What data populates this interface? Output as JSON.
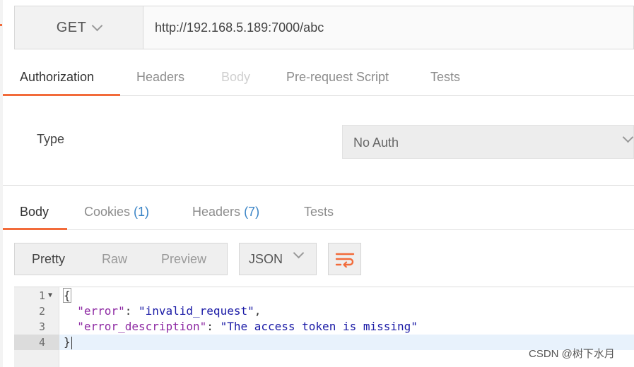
{
  "request": {
    "method": "GET",
    "url": "http://192.168.5.189:7000/abc"
  },
  "request_tabs": [
    {
      "label": "Authorization",
      "state": "active"
    },
    {
      "label": "Headers",
      "state": "normal"
    },
    {
      "label": "Body",
      "state": "disabled"
    },
    {
      "label": "Pre-request Script",
      "state": "normal"
    },
    {
      "label": "Tests",
      "state": "normal"
    }
  ],
  "auth": {
    "type_label": "Type",
    "type_value": "No Auth"
  },
  "response_tabs": [
    {
      "label": "Body",
      "state": "active"
    },
    {
      "label": "Cookies",
      "count": "(1)"
    },
    {
      "label": "Headers",
      "count": "(7)"
    },
    {
      "label": "Tests"
    }
  ],
  "body_toolbar": {
    "formats": [
      "Pretty",
      "Raw",
      "Preview"
    ],
    "active_format": "Pretty",
    "language": "JSON",
    "wrap_icon": "wrap-lines-icon"
  },
  "response_body": {
    "line_numbers": [
      "1",
      "2",
      "3",
      "4"
    ],
    "open_brace": "{",
    "close_brace": "}",
    "fields": [
      {
        "key": "\"error\"",
        "value": "\"invalid_request\"",
        "trailing": ","
      },
      {
        "key": "\"error_description\"",
        "value": "\"The access token is missing\"",
        "trailing": ""
      }
    ]
  },
  "credit": "CSDN @树下水月",
  "colors": {
    "accent": "#f26b3a",
    "count_blue": "#3a84c6",
    "json_key": "#8e2aa3",
    "json_string": "#1a1aa6"
  }
}
